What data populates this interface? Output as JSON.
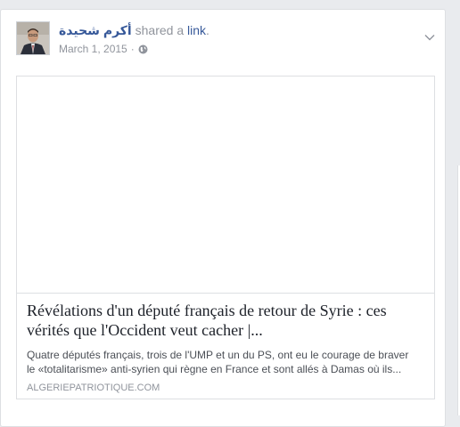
{
  "post": {
    "author": "أكرم شحيدة",
    "action": " shared a ",
    "object": "link",
    "period": ".",
    "date": "March 1, 2015",
    "separator": "·",
    "privacy_icon": "globe-icon",
    "menu_icon": "chevron-down-icon"
  },
  "link_preview": {
    "title": "Révélations d'un député français de retour de Syrie : ces vérités que l'Occident veut cacher |...",
    "description_line1": "Quatre députés français, trois de l'UMP et un du PS, ont eu le courage de braver",
    "description_line2": "le «totalitarisme» anti-syrien qui règne en France et sont allés à Damas où ils...",
    "domain": "ALGERIEPATRIOTIQUE.COM"
  },
  "colors": {
    "link": "#365899",
    "meta": "#90949c",
    "title": "#1d2129",
    "background": "#e9ebee"
  }
}
